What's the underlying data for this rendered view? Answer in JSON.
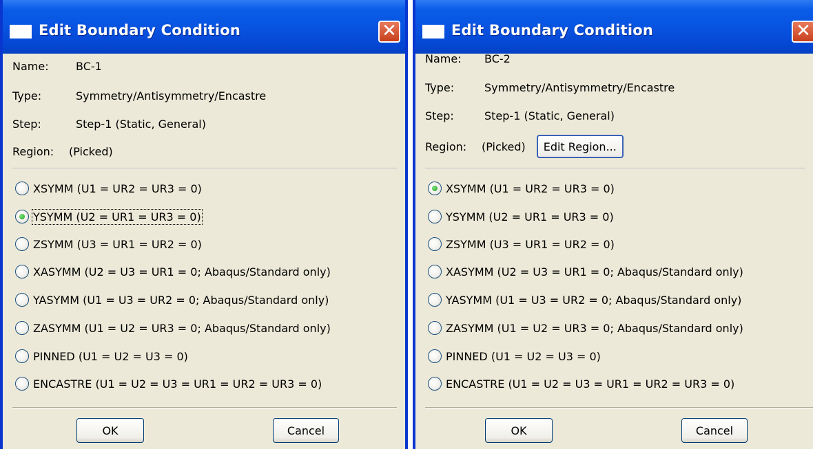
{
  "dialogs": [
    {
      "title": "Edit Boundary Condition",
      "close_glyph": "✕",
      "labels": {
        "name": "Name:",
        "type": "Type:",
        "step": "Step:",
        "region": "Region:"
      },
      "name": "BC-1",
      "type": "Symmetry/Antisymmetry/Encastre",
      "step": "Step-1 (Static, General)",
      "region": "(Picked)",
      "options": [
        "XSYMM (U1 = UR2 = UR3 = 0)",
        "YSYMM (U2 = UR1 = UR3 = 0)",
        "ZSYMM (U3 = UR1 = UR2 = 0)",
        "XASYMM (U2 = U3 = UR1 = 0; Abaqus/Standard only)",
        "YASYMM (U1 = U3 = UR2 = 0; Abaqus/Standard only)",
        "ZASYMM (U1 = U2 = UR3 = 0; Abaqus/Standard only)",
        "PINNED (U1 = U2 = U3 = 0)",
        "ENCASTRE (U1 = U2 = U3 = UR1 = UR2 = UR3 = 0)"
      ],
      "selected_option": "YSYMM (U2 = UR1 = UR3 = 0)",
      "ok_label": "OK",
      "cancel_label": "Cancel"
    },
    {
      "title": "Edit Boundary Condition",
      "close_glyph": "✕",
      "labels": {
        "name": "Name:",
        "type": "Type:",
        "step": "Step:",
        "region": "Region:"
      },
      "name": "BC-2",
      "type": "Symmetry/Antisymmetry/Encastre",
      "step": "Step-1 (Static, General)",
      "region": "(Picked)",
      "edit_region_label": "Edit Region...",
      "options": [
        "XSYMM (U1 = UR2 = UR3 = 0)",
        "YSYMM (U2 = UR1 = UR3 = 0)",
        "ZSYMM (U3 = UR1 = UR2 = 0)",
        "XASYMM (U2 = U3 = UR1 = 0; Abaqus/Standard only)",
        "YASYMM (U1 = U3 = UR2 = 0; Abaqus/Standard only)",
        "ZASYMM (U1 = U2 = UR3 = 0; Abaqus/Standard only)",
        "PINNED (U1 = U2 = U3 = 0)",
        "ENCASTRE (U1 = U2 = U3 = UR1 = UR2 = UR3 = 0)"
      ],
      "selected_option": "XSYMM (U1 = UR2 = UR3 = 0)",
      "ok_label": "OK",
      "cancel_label": "Cancel"
    }
  ],
  "colors": {
    "titlebar": "#0854e1",
    "window_border": "#0a36d0",
    "dialog_face": "#ece9d8",
    "close_button": "#c8401d",
    "radio_selected": "#21a121"
  },
  "icons": {
    "window": "window-icon",
    "close": "close-icon",
    "radio": "radio-button"
  }
}
